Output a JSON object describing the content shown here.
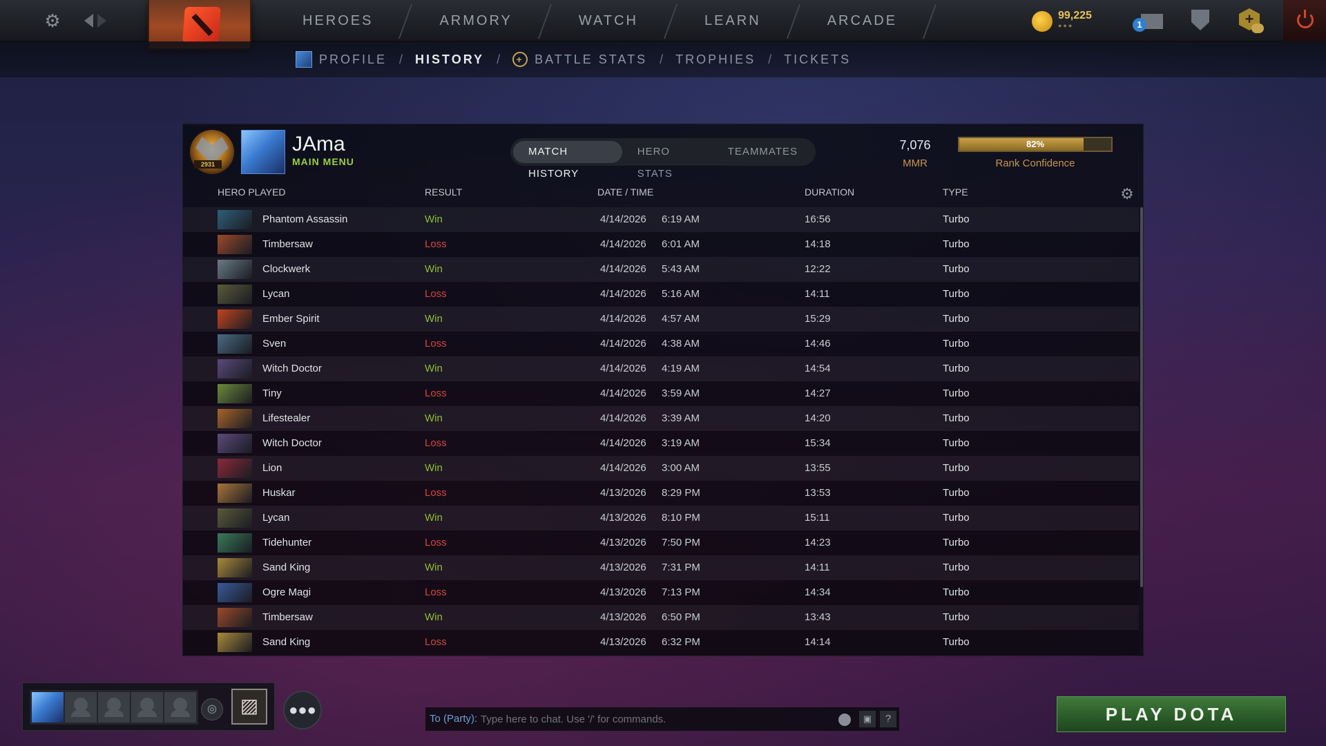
{
  "topbar": {
    "nav": [
      "HEROES",
      "ARMORY",
      "WATCH",
      "LEARN",
      "ARCADE"
    ],
    "currency_amount": "99,225",
    "mail_badge": "1"
  },
  "subnav": {
    "profile": "PROFILE",
    "history": "HISTORY",
    "battle_stats": "BATTLE STATS",
    "trophies": "TROPHIES",
    "tickets": "TICKETS",
    "separator": "/"
  },
  "player": {
    "name": "JAma",
    "subtitle": "MAIN MENU",
    "rank_number": "2931"
  },
  "tabs": [
    "MATCH HISTORY",
    "HERO STATS",
    "TEAMMATES"
  ],
  "mmr": {
    "value": "7,076",
    "label": "MMR",
    "confidence_percent": 82,
    "confidence_text": "82%",
    "confidence_label": "Rank Confidence"
  },
  "columns": {
    "hero": "HERO PLAYED",
    "result": "RESULT",
    "datetime": "DATE / TIME",
    "duration": "DURATION",
    "type": "TYPE"
  },
  "matches": [
    {
      "hero": "Phantom Assassin",
      "result": "Win",
      "date": "4/14/2026",
      "time": "6:19 AM",
      "duration": "16:56",
      "type": "Turbo"
    },
    {
      "hero": "Timbersaw",
      "result": "Loss",
      "date": "4/14/2026",
      "time": "6:01 AM",
      "duration": "14:18",
      "type": "Turbo"
    },
    {
      "hero": "Clockwerk",
      "result": "Win",
      "date": "4/14/2026",
      "time": "5:43 AM",
      "duration": "12:22",
      "type": "Turbo"
    },
    {
      "hero": "Lycan",
      "result": "Loss",
      "date": "4/14/2026",
      "time": "5:16 AM",
      "duration": "14:11",
      "type": "Turbo"
    },
    {
      "hero": "Ember Spirit",
      "result": "Win",
      "date": "4/14/2026",
      "time": "4:57 AM",
      "duration": "15:29",
      "type": "Turbo"
    },
    {
      "hero": "Sven",
      "result": "Loss",
      "date": "4/14/2026",
      "time": "4:38 AM",
      "duration": "14:46",
      "type": "Turbo"
    },
    {
      "hero": "Witch Doctor",
      "result": "Win",
      "date": "4/14/2026",
      "time": "4:19 AM",
      "duration": "14:54",
      "type": "Turbo"
    },
    {
      "hero": "Tiny",
      "result": "Loss",
      "date": "4/14/2026",
      "time": "3:59 AM",
      "duration": "14:27",
      "type": "Turbo"
    },
    {
      "hero": "Lifestealer",
      "result": "Win",
      "date": "4/14/2026",
      "time": "3:39 AM",
      "duration": "14:20",
      "type": "Turbo"
    },
    {
      "hero": "Witch Doctor",
      "result": "Loss",
      "date": "4/14/2026",
      "time": "3:19 AM",
      "duration": "15:34",
      "type": "Turbo"
    },
    {
      "hero": "Lion",
      "result": "Win",
      "date": "4/14/2026",
      "time": "3:00 AM",
      "duration": "13:55",
      "type": "Turbo"
    },
    {
      "hero": "Huskar",
      "result": "Loss",
      "date": "4/13/2026",
      "time": "8:29 PM",
      "duration": "13:53",
      "type": "Turbo"
    },
    {
      "hero": "Lycan",
      "result": "Win",
      "date": "4/13/2026",
      "time": "8:10 PM",
      "duration": "15:11",
      "type": "Turbo"
    },
    {
      "hero": "Tidehunter",
      "result": "Loss",
      "date": "4/13/2026",
      "time": "7:50 PM",
      "duration": "14:23",
      "type": "Turbo"
    },
    {
      "hero": "Sand King",
      "result": "Win",
      "date": "4/13/2026",
      "time": "7:31 PM",
      "duration": "14:11",
      "type": "Turbo"
    },
    {
      "hero": "Ogre Magi",
      "result": "Loss",
      "date": "4/13/2026",
      "time": "7:13 PM",
      "duration": "14:34",
      "type": "Turbo"
    },
    {
      "hero": "Timbersaw",
      "result": "Win",
      "date": "4/13/2026",
      "time": "6:50 PM",
      "duration": "13:43",
      "type": "Turbo"
    },
    {
      "hero": "Sand King",
      "result": "Loss",
      "date": "4/13/2026",
      "time": "6:32 PM",
      "duration": "14:14",
      "type": "Turbo"
    }
  ],
  "hero_colors": {
    "Phantom Assassin": "#2f5f7a",
    "Timbersaw": "#9a4a2a",
    "Clockwerk": "#6a7a86",
    "Lycan": "#5a5a3a",
    "Ember Spirit": "#c2441e",
    "Sven": "#4a6a82",
    "Witch Doctor": "#5a4a7a",
    "Tiny": "#6a8a3a",
    "Lifestealer": "#a8642a",
    "Lion": "#8a2a3a",
    "Huskar": "#a8743a",
    "Tidehunter": "#3a7a5a",
    "Sand King": "#a88a3a",
    "Ogre Magi": "#3a5a9a"
  },
  "result_colors": {
    "Win": "#8fbf2e",
    "Loss": "#d1473e"
  },
  "chat": {
    "prefix": "To (Party):",
    "placeholder": "Type here to chat. Use '/' for commands."
  },
  "play_button": "PLAY DOTA"
}
